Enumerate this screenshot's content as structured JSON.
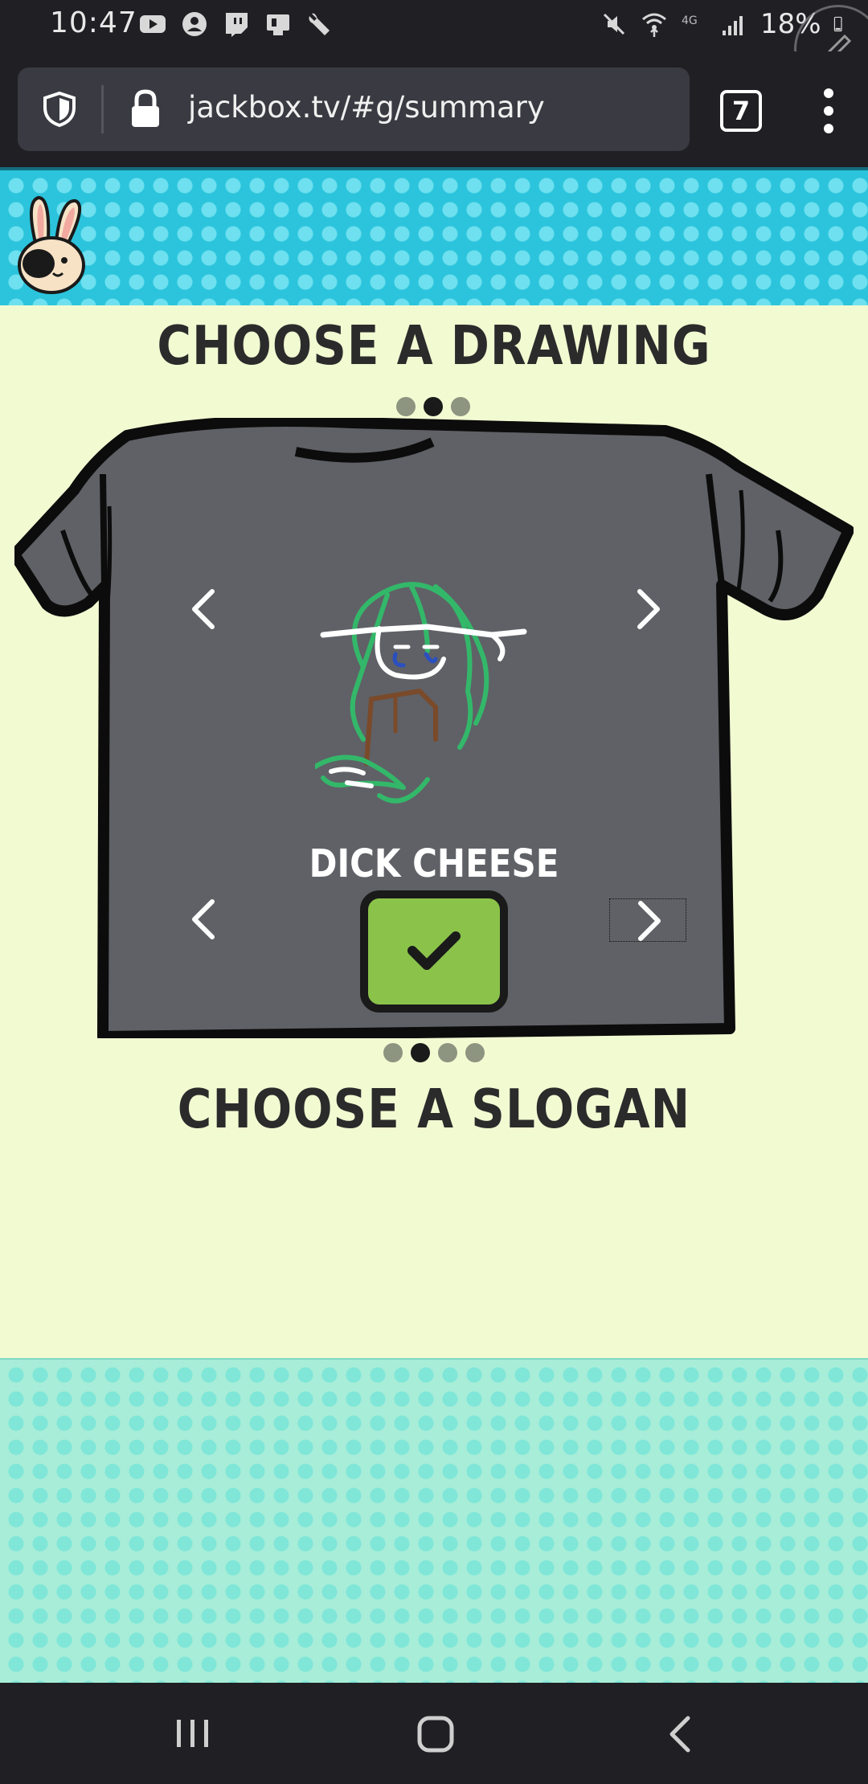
{
  "status_bar": {
    "time": "10:47",
    "battery": "18%",
    "left_icons": [
      "youtube-icon",
      "account-icon",
      "twitch-icon",
      "sim-icon",
      "wrench-icon"
    ],
    "right_icons": [
      "mute-icon",
      "wifi-icon",
      "lte-icon",
      "signal-icon",
      "battery-icon"
    ]
  },
  "browser": {
    "url": "jackbox.tv/#g/summary",
    "tab_count": "7"
  },
  "game": {
    "drawing_heading": "CHOOSE A DRAWING",
    "slogan_heading": "CHOOSE A SLOGAN",
    "slogan": "DICK CHEESE",
    "drawing_pages": {
      "total": 3,
      "current": 2
    },
    "slogan_pages": {
      "total": 4,
      "current": 2
    },
    "colors": {
      "header_band": "#2bc4dc",
      "background": "#f2fad2",
      "shirt": "#5f6166",
      "confirm": "#8bc34a",
      "footer_band": "#a8edd8"
    }
  },
  "nav": {
    "icons": [
      "recent-apps-icon",
      "home-icon",
      "back-icon"
    ]
  }
}
